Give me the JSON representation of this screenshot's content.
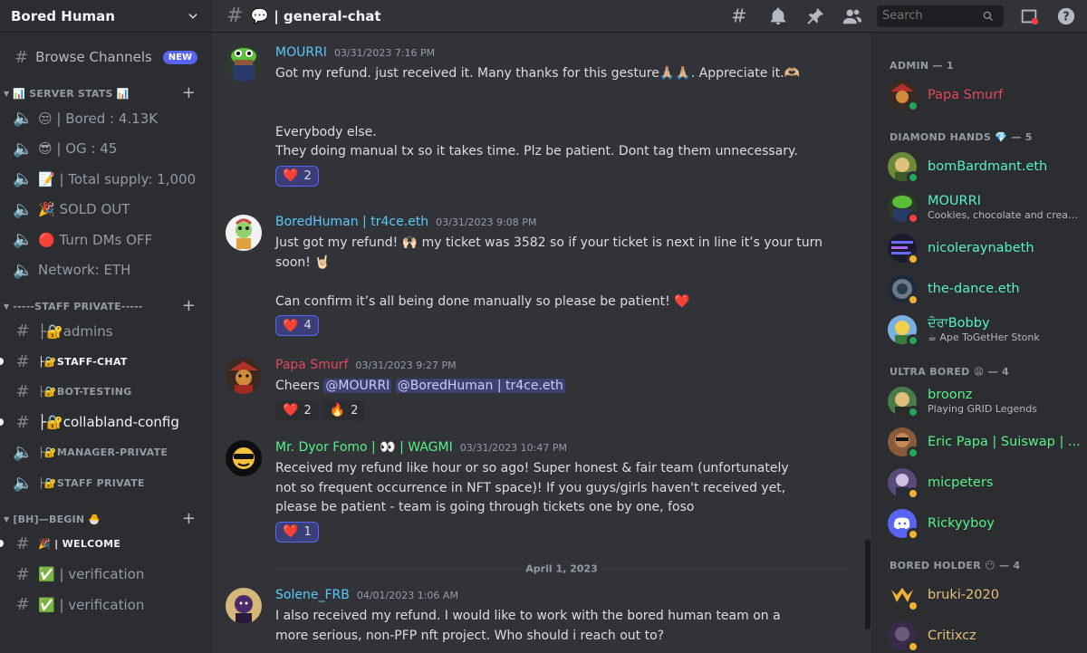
{
  "server": {
    "name": "Bored Human"
  },
  "sidebar": {
    "browse": {
      "label": "Browse Channels",
      "badge": "NEW"
    },
    "categories": [
      {
        "name": "📊 SERVER STATS 📊",
        "channels": [
          {
            "type": "voice",
            "name": "😒 | Bored : 4.13K"
          },
          {
            "type": "voice",
            "name": "😎 | OG : 45"
          },
          {
            "type": "voice",
            "name": "📝 | Total supply: 1,000"
          },
          {
            "type": "voice",
            "name": "🎉 SOLD OUT"
          },
          {
            "type": "voice",
            "name": "🔴 Turn DMs OFF"
          },
          {
            "type": "voice",
            "name": "Network: ETH"
          }
        ]
      },
      {
        "name": "-----STAFF PRIVATE-----",
        "channels": [
          {
            "type": "text",
            "name": "├🔐admins"
          },
          {
            "type": "text",
            "name": "├🔐STAFF-CHAT"
          },
          {
            "type": "text",
            "name": "├🔐BOT-TESTING"
          },
          {
            "type": "text",
            "name": "├🔐collabland-config"
          },
          {
            "type": "voice",
            "name": "├🔐MANAGER-PRIVATE"
          },
          {
            "type": "voice",
            "name": "├🔐STAFF PRIVATE"
          }
        ]
      },
      {
        "name": "[BH]—BEGIN 🐣",
        "channels": [
          {
            "type": "text",
            "name": "🎉 | WELCOME"
          },
          {
            "type": "text",
            "name": "✅ | verification"
          },
          {
            "type": "text",
            "name": "✅ | verification"
          }
        ]
      }
    ]
  },
  "topbar": {
    "channel_emoji": "💬",
    "channel_name": "| general-chat",
    "search_placeholder": "Search"
  },
  "messages": [
    {
      "author": "MOURRI",
      "author_color": "#5ac8fa",
      "timestamp": "03/31/2023 7:16 PM",
      "lines": [
        "Got my refund. just received it. Many thanks for this gesture🙏🏼🙏🏼. Appreciate it.🫶🏼",
        "",
        "",
        "Everybody else.",
        "They doing manual tx so it takes time. Plz be patient. Dont tag them unnecessary."
      ],
      "reactions": [
        {
          "emoji": "❤️",
          "count": "2",
          "mine": true
        }
      ]
    },
    {
      "author": "BoredHuman | tr4ce.eth",
      "author_color": "#5ac8fa",
      "timestamp": "03/31/2023 9:08 PM",
      "lines": [
        "Just got my refund! 🙌🏻 my ticket was 3582 so if your ticket is next in line it’s your turn soon! 🤘🏻",
        "",
        "Can confirm it’s all being done manually so please be patient! ❤️"
      ],
      "reactions": [
        {
          "emoji": "❤️",
          "count": "4",
          "mine": true
        }
      ]
    },
    {
      "author": "Papa Smurf",
      "author_color": "#e0495a",
      "timestamp": "03/31/2023 9:27 PM",
      "text_prefix": "Cheers ",
      "mentions": [
        "@MOURRI",
        "@BoredHuman | tr4ce.eth"
      ],
      "reactions": [
        {
          "emoji": "❤️",
          "count": "2",
          "mine": false
        },
        {
          "emoji": "🔥",
          "count": "2",
          "mine": false
        }
      ]
    },
    {
      "author": "Mr. Dyor Fomo | 👀 | WAGMI",
      "author_color": "#57f287",
      "timestamp": "03/31/2023 10:47 PM",
      "lines": [
        "Received my refund like hour or so ago! Super honest & fair team (unfortunately not so frequent occurrence in NFT space)! If you guys/girls haven't received yet, please be patient - team is going through tickets one by one, foso"
      ],
      "reactions": [
        {
          "emoji": "❤️",
          "count": "1",
          "mine": true
        }
      ]
    },
    {
      "author": "Solene_FRB",
      "author_color": "#5ac8fa",
      "timestamp": "04/01/2023 1:06 AM",
      "lines": [
        "I also received my refund. I would like to work with the bored human team on a more serious, non-PFP nft project. Who should i reach out to?"
      ],
      "reactions": []
    }
  ],
  "date_divider": "April 1, 2023",
  "members": {
    "groups": [
      {
        "label": "ADMIN — 1",
        "members": [
          {
            "name": "Papa Smurf",
            "color": "#e0495a",
            "status": "online",
            "activity": ""
          }
        ]
      },
      {
        "label": "DIAMOND HANDS 💎 — 5",
        "members": [
          {
            "name": "bomBardmant.eth",
            "color": "#57f2c8",
            "status": "online",
            "activity": ""
          },
          {
            "name": "MOURRI",
            "color": "#57f2c8",
            "status": "dnd",
            "activity": "Cookies, chocolate and cream..."
          },
          {
            "name": "nicoleraynabeth",
            "color": "#57f2c8",
            "status": "idle",
            "activity": ""
          },
          {
            "name": "the-dance.eth",
            "color": "#57f2c8",
            "status": "idle",
            "activity": ""
          },
          {
            "name": "ਦੋਰਾBobby",
            "color": "#57f2c8",
            "status": "online",
            "activity": "☕ Ape ToGetHer Stonk"
          }
        ]
      },
      {
        "label": "ULTRA BORED 😩 — 4",
        "members": [
          {
            "name": "broonz",
            "color": "#57f287",
            "status": "online",
            "activity": "Playing GRID Legends"
          },
          {
            "name": "Eric Papa | Suiswap | ...",
            "color": "#57f287",
            "status": "online",
            "activity": ""
          },
          {
            "name": "micpeters",
            "color": "#57f287",
            "status": "idle",
            "activity": ""
          },
          {
            "name": "Rickyyboy",
            "color": "#57f287",
            "status": "idle",
            "activity": ""
          }
        ]
      },
      {
        "label": "BORED HOLDER 😶 — 4",
        "members": [
          {
            "name": "bruki-2020",
            "color": "#e5c07b",
            "status": "idle",
            "activity": ""
          },
          {
            "name": "Critixcz",
            "color": "#e5c07b",
            "status": "idle",
            "activity": ""
          }
        ]
      }
    ]
  }
}
